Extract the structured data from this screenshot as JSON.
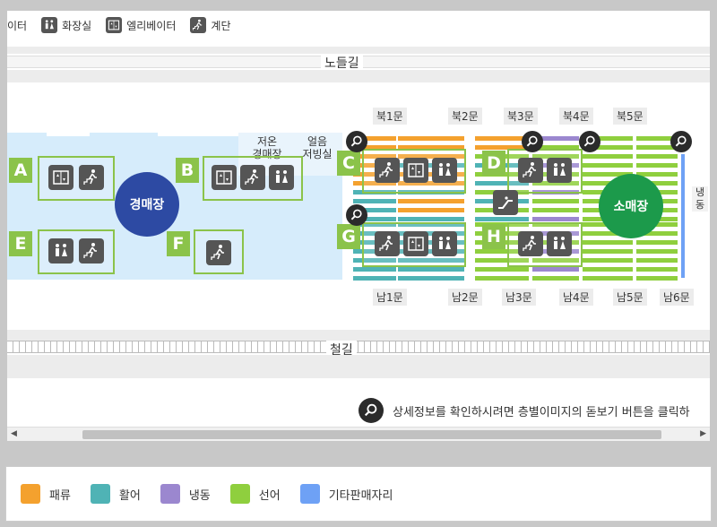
{
  "legend_top": [
    {
      "icon": "elevator-icon",
      "label": "이터"
    },
    {
      "icon": "restroom-icon",
      "label": "화장실"
    },
    {
      "icon": "elevator-icon",
      "label": "엘리베이터"
    },
    {
      "icon": "stairs-icon",
      "label": "계단"
    }
  ],
  "roads": {
    "top": "노들길",
    "bottom": "철길"
  },
  "areas": {
    "auction": "경매장",
    "retail": "소매장",
    "auction_low_temp": "저온\n경매장",
    "ice_storage": "얼음\n저빙실",
    "side_label": "냉\n동"
  },
  "zones": [
    "A",
    "B",
    "C",
    "D",
    "E",
    "F",
    "G",
    "H"
  ],
  "gates_north": [
    "북1문",
    "북2문",
    "북3문",
    "북4문",
    "북5문"
  ],
  "gates_south": [
    "남1문",
    "남2문",
    "남3문",
    "남4문",
    "남5문",
    "남6문"
  ],
  "hint": "상세정보를 확인하시려면 층별이미지의 돋보기 버튼을 클릭하",
  "legend_bottom": [
    {
      "label": "패류",
      "color": "#f4a12e"
    },
    {
      "label": "활어",
      "color": "#4fb3b5"
    },
    {
      "label": "냉동",
      "color": "#9b87cf"
    },
    {
      "label": "선어",
      "color": "#8fcf3e"
    },
    {
      "label": "기타판매자리",
      "color": "#6ea1f5"
    }
  ],
  "colors": {
    "zone_green": "#8bc34a",
    "auction_blue": "#2d4aa3",
    "retail_green": "#1c9a4b",
    "area_blue": "#d6ecfb"
  }
}
